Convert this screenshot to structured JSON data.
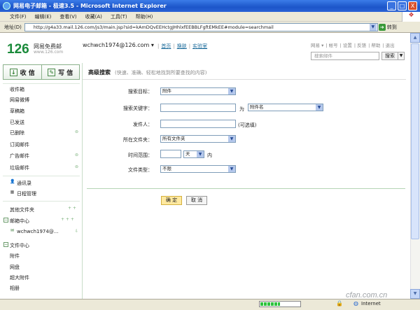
{
  "window": {
    "title": "网易电子邮箱 - 极速3.5 - Microsoft Internet Explorer",
    "min": "_",
    "max": "□",
    "close": "X"
  },
  "menu": [
    "文件(F)",
    "编辑(E)",
    "查看(V)",
    "收藏(A)",
    "工具(T)",
    "帮助(H)"
  ],
  "address": {
    "label": "地址(D)",
    "url": "http://g4a33.mail.126.com/js3/main.jsp?sid=kAmDQvEEHctgJHhlxfEEBBLFgftEMkEE#module=searchmail",
    "go_label": "转到"
  },
  "header": {
    "logo": "126",
    "brand": "网易免费邮",
    "brand_url": "www.126.com",
    "user": "wchwch1974@126.com ▾",
    "links": [
      "首页",
      "换肤",
      "实验室"
    ],
    "top_links": [
      "网易 ▾",
      "帐号",
      "设置",
      "反馈",
      "帮助",
      "退出"
    ],
    "search_placeholder": "搜索邮件",
    "search_button": "搜索"
  },
  "sidebar": {
    "receive": "收 信",
    "compose": "写 信",
    "receive_icon": "↓",
    "compose_icon": "✎",
    "folders": [
      "收件箱",
      "网易微博",
      "草稿箱",
      "已发送",
      "已删除",
      "订阅邮件",
      "广告邮件",
      "垃圾邮件"
    ],
    "tools": [
      "通讯录",
      "日程管理"
    ],
    "other_folders": "其他文件夹",
    "mail_center": "邮箱中心",
    "mail_account": "wchwch1974@...",
    "file_center": "文件中心",
    "file_items": [
      "附件",
      "网盘",
      "超大附件",
      "相册"
    ]
  },
  "search": {
    "title": "高级搜索",
    "subtitle": "(快速、准确、轻松地找到所要查找的内容)",
    "target_label": "搜索目标：",
    "target_value": "附件",
    "keyword_label": "搜索关键字：",
    "keyword_for": "为",
    "keyword_type": "附件名",
    "sender_label": "发件人：",
    "sender_hint": "(可选填)",
    "folder_label": "所在文件夹：",
    "folder_value": "所有文件夹",
    "time_label": "时间范围：",
    "time_unit": "天",
    "time_suffix": "内",
    "filetype_label": "文件类型：",
    "filetype_value": "不限",
    "ok_button": "确 定",
    "cancel_button": "取 消"
  },
  "status": {
    "zone": "Internet",
    "progress": 0.5
  },
  "watermark": "cfan.com.cn"
}
